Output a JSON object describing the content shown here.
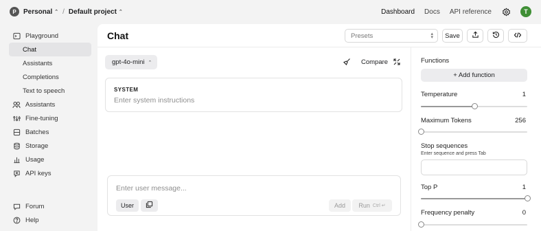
{
  "header": {
    "org_initial": "P",
    "org_name": "Personal",
    "separator": "/",
    "project_name": "Default project",
    "nav": [
      "Dashboard",
      "Docs",
      "API reference"
    ],
    "active_nav": "Dashboard",
    "user_initial": "T",
    "user_avatar_color": "#3f8f35"
  },
  "sidebar": {
    "items": [
      {
        "label": "Playground",
        "icon": "playground-icon"
      },
      {
        "label": "Chat",
        "sub": true,
        "active": true
      },
      {
        "label": "Assistants",
        "sub": true
      },
      {
        "label": "Completions",
        "sub": true
      },
      {
        "label": "Text to speech",
        "sub": true
      },
      {
        "label": "Assistants",
        "icon": "assistants-icon"
      },
      {
        "label": "Fine-tuning",
        "icon": "fine-tuning-icon"
      },
      {
        "label": "Batches",
        "icon": "batches-icon"
      },
      {
        "label": "Storage",
        "icon": "storage-icon"
      },
      {
        "label": "Usage",
        "icon": "usage-icon"
      },
      {
        "label": "API keys",
        "icon": "key-icon"
      }
    ],
    "bottom": [
      {
        "label": "Forum",
        "icon": "forum-icon"
      },
      {
        "label": "Help",
        "icon": "help-icon"
      }
    ]
  },
  "main": {
    "title": "Chat",
    "presets_placeholder": "Presets",
    "save_label": "Save",
    "toolbar_icons": [
      "share-icon",
      "history-icon",
      "code-icon"
    ]
  },
  "chat": {
    "model": "gpt-4o-mini",
    "compare_label": "Compare",
    "system_label": "SYSTEM",
    "system_placeholder": "Enter system instructions",
    "composer_placeholder": "Enter user message...",
    "role_label": "User",
    "add_label": "Add",
    "run_label": "Run",
    "run_shortcut": "Ctrl ↵"
  },
  "settings": {
    "functions_label": "Functions",
    "add_function_label": "+ Add function",
    "temperature": {
      "label": "Temperature",
      "value": "1",
      "fraction": 0.5
    },
    "max_tokens": {
      "label": "Maximum Tokens",
      "value": "256",
      "fraction": 0.0
    },
    "stop": {
      "label": "Stop sequences",
      "hint": "Enter sequence and press Tab"
    },
    "top_p": {
      "label": "Top P",
      "value": "1",
      "fraction": 1.0
    },
    "frequency_penalty": {
      "label": "Frequency penalty",
      "value": "0",
      "fraction": 0.0
    }
  }
}
